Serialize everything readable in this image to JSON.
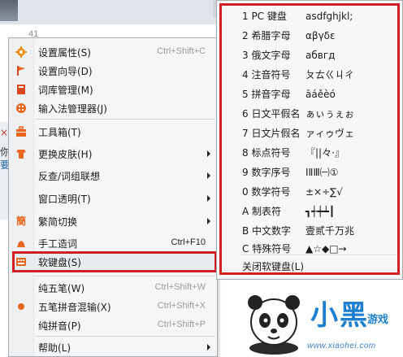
{
  "background": {
    "count": "41",
    "side_chars": [
      "×",
      "你",
      "要"
    ]
  },
  "menu": {
    "items": [
      {
        "label": "设置属性(S)",
        "shortcut": "Ctrl+Shift+C",
        "icon": "gear-icon"
      },
      {
        "label": "设置向导(D)",
        "shortcut": "",
        "icon": "flag-icon"
      },
      {
        "label": "词库管理(M)",
        "shortcut": "",
        "icon": "book-icon"
      },
      {
        "label": "输入法管理器(J)",
        "shortcut": "",
        "icon": "manager-icon"
      },
      {
        "label": "工具箱(T)",
        "shortcut": "",
        "icon": "toolbox-icon"
      },
      {
        "label": "更换皮肤(H)",
        "shortcut": "",
        "icon": "skin-icon"
      },
      {
        "label": "反查/词组联想",
        "shortcut": ""
      },
      {
        "label": "窗口透明(T)",
        "shortcut": ""
      },
      {
        "label": "繁简切换",
        "shortcut": "",
        "icon": "traditional-simplified-icon"
      },
      {
        "label": "手工造词",
        "shortcut": "Ctrl+F10",
        "icon": "hand-word-icon"
      },
      {
        "label": "软键盘(S)",
        "shortcut": "",
        "icon": "keyboard-icon"
      },
      {
        "label": "纯五笔(W)",
        "shortcut": "Ctrl+Shift+W"
      },
      {
        "label": "五笔拼音混输(X)",
        "shortcut": "Ctrl+Shift+X"
      },
      {
        "label": "纯拼音(P)",
        "shortcut": "Ctrl+Shift+P"
      },
      {
        "label": "帮助(L)",
        "shortcut": ""
      }
    ]
  },
  "soft_keyboard": {
    "items": [
      {
        "label": "1 PC 键盘",
        "sample": "asdfghjkl;"
      },
      {
        "label": "2 希腊字母",
        "sample": "αβγδε"
      },
      {
        "label": "3 俄文字母",
        "sample": "абвгд"
      },
      {
        "label": "4 注音符号",
        "sample": "ㄆㄊㄍㄐㄔ"
      },
      {
        "label": "5 拼音字母",
        "sample": "āáěèó"
      },
      {
        "label": "6 日文平假名",
        "sample": "ぁぃぅぇぉ"
      },
      {
        "label": "7 日文片假名",
        "sample": "ァィゥヴェ"
      },
      {
        "label": "8 标点符号",
        "sample": "『||々·』"
      },
      {
        "label": "9 数字序号",
        "sample": "ⅠⅡⅢ㈠①"
      },
      {
        "label": "0 数学符号",
        "sample": "±×÷∑√"
      },
      {
        "label": "A 制表符",
        "sample": "┓┽┿┷┃"
      },
      {
        "label": "B 中文数字",
        "sample": "壹贰千万兆"
      },
      {
        "label": "C 特殊符号",
        "sample": "▲☆◆□→"
      }
    ],
    "close_label": "关闭软键盘(L)"
  },
  "watermark": {
    "brand": "小黑",
    "sub": "游戏",
    "url": "www.xiaohei.com"
  },
  "colors": {
    "highlight_border": "#d21f24",
    "brand_blue": "#1e7fd0"
  }
}
